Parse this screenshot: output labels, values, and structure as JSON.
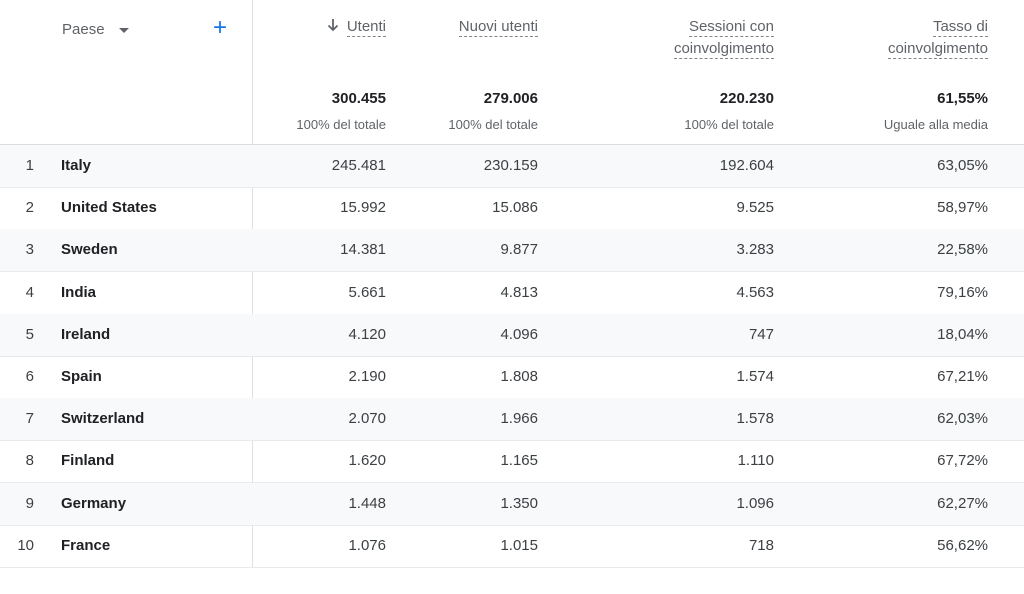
{
  "dimension": {
    "label": "Paese",
    "add_icon": "plus-icon"
  },
  "columns": [
    {
      "key": "utenti",
      "title": [
        "Utenti"
      ],
      "sorted": true,
      "sort_icon": "arrow-down-icon",
      "total": "300.455",
      "total_sub": "100% del totale"
    },
    {
      "key": "nuovi_utenti",
      "title": [
        "Nuovi utenti"
      ],
      "sorted": false,
      "total": "279.006",
      "total_sub": "100% del totale"
    },
    {
      "key": "sessioni",
      "title": [
        "Sessioni con",
        "coinvolgimento"
      ],
      "sorted": false,
      "total": "220.230",
      "total_sub": "100% del totale"
    },
    {
      "key": "tasso",
      "title": [
        "Tasso di",
        "coinvolgimento"
      ],
      "sorted": false,
      "total": "61,55%",
      "total_sub": "Uguale alla media"
    }
  ],
  "rows": [
    {
      "index": "1",
      "country": "Italy",
      "values": [
        "245.481",
        "230.159",
        "192.604",
        "63,05%"
      ]
    },
    {
      "index": "2",
      "country": "United States",
      "values": [
        "15.992",
        "15.086",
        "9.525",
        "58,97%"
      ]
    },
    {
      "index": "3",
      "country": "Sweden",
      "values": [
        "14.381",
        "9.877",
        "3.283",
        "22,58%"
      ]
    },
    {
      "index": "4",
      "country": "India",
      "values": [
        "5.661",
        "4.813",
        "4.563",
        "79,16%"
      ]
    },
    {
      "index": "5",
      "country": "Ireland",
      "values": [
        "4.120",
        "4.096",
        "747",
        "18,04%"
      ]
    },
    {
      "index": "6",
      "country": "Spain",
      "values": [
        "2.190",
        "1.808",
        "1.574",
        "67,21%"
      ]
    },
    {
      "index": "7",
      "country": "Switzerland",
      "values": [
        "2.070",
        "1.966",
        "1.578",
        "62,03%"
      ]
    },
    {
      "index": "8",
      "country": "Finland",
      "values": [
        "1.620",
        "1.165",
        "1.110",
        "67,72%"
      ]
    },
    {
      "index": "9",
      "country": "Germany",
      "values": [
        "1.448",
        "1.350",
        "1.096",
        "62,27%"
      ]
    },
    {
      "index": "10",
      "country": "France",
      "values": [
        "1.076",
        "1.015",
        "718",
        "56,62%"
      ]
    }
  ],
  "colors": {
    "accent": "#1a73e8",
    "shaded_row": "#f8f9fa",
    "border": "#dadce0"
  }
}
